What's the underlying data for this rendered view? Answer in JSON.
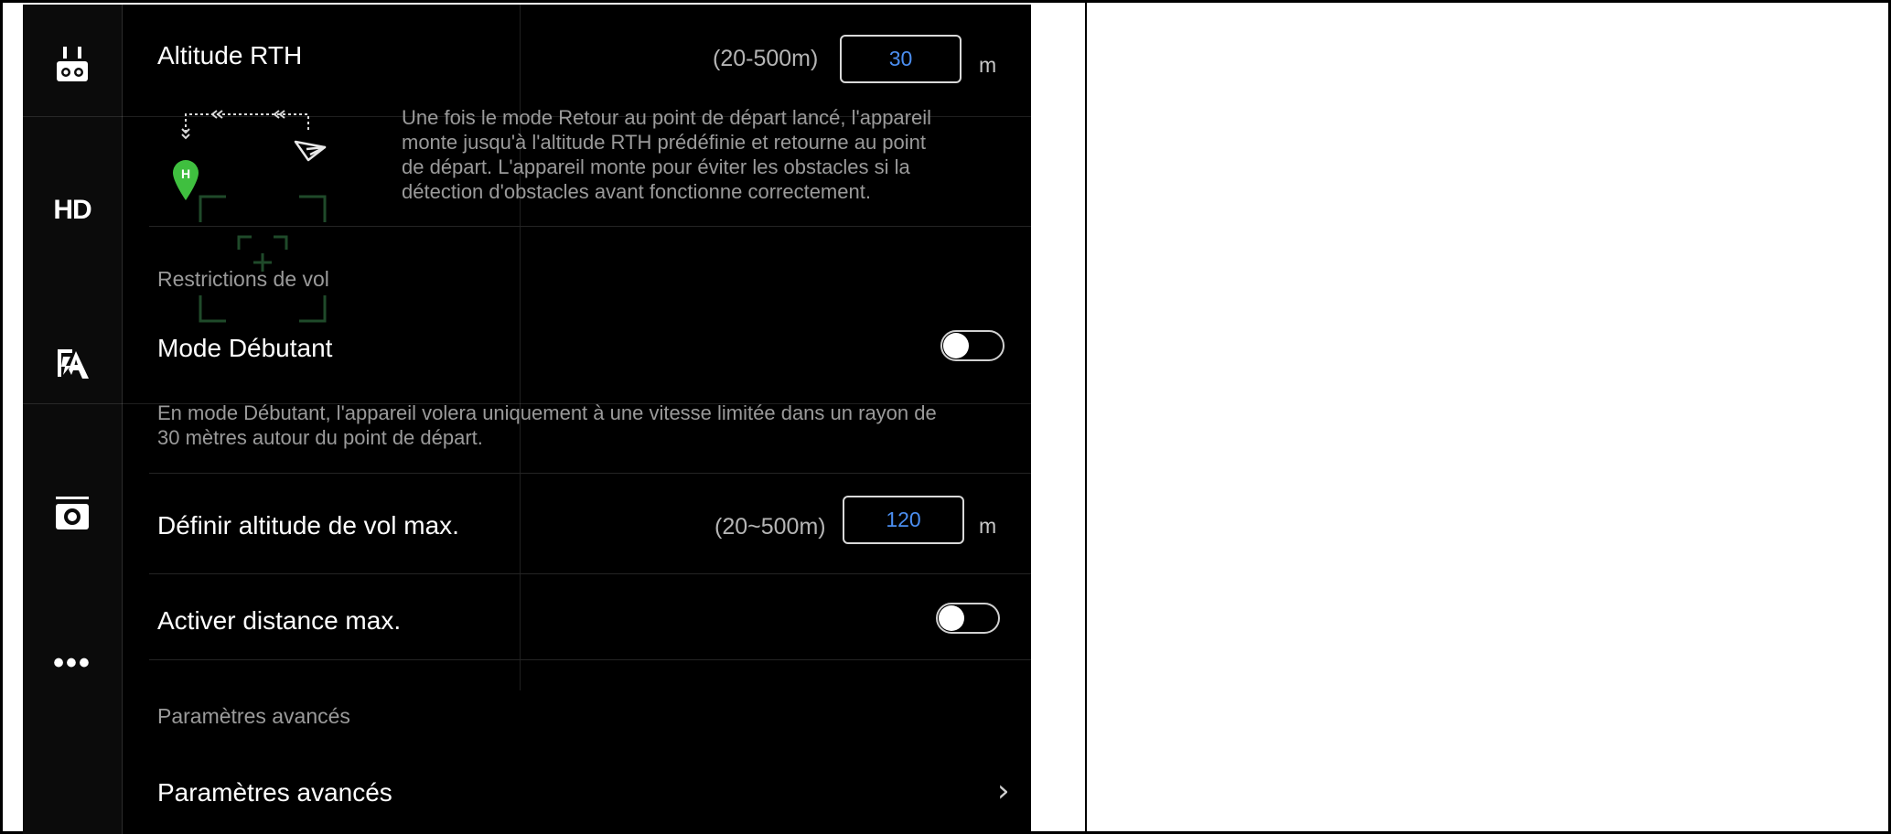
{
  "rail": {
    "items": [
      {
        "icon": "remote-controller-icon"
      },
      {
        "icon": "hd-icon",
        "label": "HD"
      },
      {
        "icon": "aircraft-battery-icon"
      },
      {
        "icon": "camera-icon"
      },
      {
        "icon": "more-icon",
        "label": "•••"
      }
    ]
  },
  "rth": {
    "title": "Altitude RTH",
    "range": "(20-500m)",
    "value": "30",
    "unit": "m",
    "description": [
      "Une fois le mode Retour au point de départ lancé, l'appareil",
      "monte jusqu'à l'altitude RTH prédéfinie et retourne au point",
      "de départ. L'appareil monte pour éviter les obstacles si la",
      "détection d'obstacles avant fonctionne correctement."
    ],
    "home_marker": "H"
  },
  "flight_restrictions": {
    "section_label": "Restrictions de vol",
    "beginner": {
      "title": "Mode Débutant",
      "enabled": false,
      "description": [
        "En mode Débutant, l'appareil volera uniquement à une vitesse limitée dans un rayon de",
        "30 mètres autour du point de départ."
      ]
    },
    "max_altitude": {
      "title": "Définir altitude de vol max.",
      "range": "(20~500m)",
      "value": "120",
      "unit": "m"
    },
    "max_distance": {
      "title": "Activer distance max.",
      "enabled": false
    }
  },
  "advanced": {
    "section_label": "Paramètres avancés",
    "item_label": "Paramètres avancés",
    "chevron": "›"
  },
  "colors": {
    "background": "#000000",
    "accent_value": "#4b8ef0",
    "home_marker": "#3fbf3f",
    "secondary_text": "#9a9a9a"
  }
}
